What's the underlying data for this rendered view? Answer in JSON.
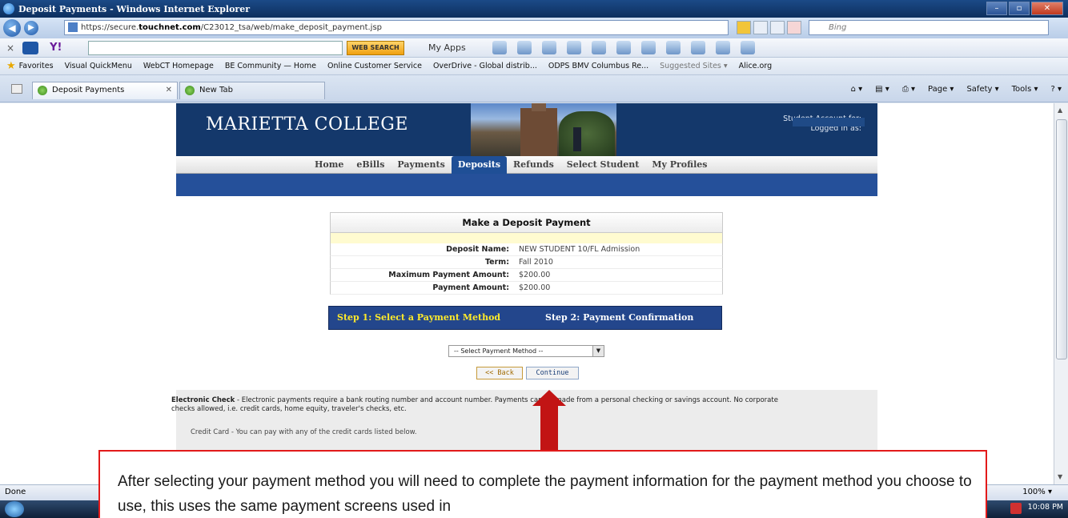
{
  "window": {
    "title": "Deposit Payments - Windows Internet Explorer"
  },
  "address_bar": {
    "url_prefix": "https://secure.",
    "url_domain": "touchnet.com",
    "url_path": "/C23012_tsa/web/make_deposit_payment.jsp",
    "search_placeholder": "Bing"
  },
  "toolbar": {
    "web_search_label": "WEB SEARCH",
    "my_apps_label": "My Apps"
  },
  "favorites": {
    "label": "Favorites",
    "items": [
      "Visual QuickMenu",
      "WebCT Homepage",
      "BE Community — Home",
      "Online Customer Service",
      "OverDrive - Global distrib...",
      "ODPS BMV Columbus Re...",
      "Suggested Sites ▾",
      "Alice.org"
    ]
  },
  "tabs": {
    "active": "Deposit Payments",
    "new_tab": "New Tab",
    "right_menu": [
      "Page ▾",
      "Safety ▾",
      "Tools ▾"
    ]
  },
  "site": {
    "college_name": "MARIETTA COLLEGE",
    "account_line1": "Student Account for:",
    "account_line2": "Logged in as:",
    "nav": [
      "Home",
      "eBills",
      "Payments",
      "Deposits",
      "Refunds",
      "Select Student",
      "My Profiles"
    ],
    "nav_active": "Deposits"
  },
  "deposit": {
    "title": "Make a Deposit Payment",
    "rows": [
      {
        "label": "Deposit Name:",
        "value": "NEW STUDENT 10/FL Admission"
      },
      {
        "label": "Term:",
        "value": "Fall 2010"
      },
      {
        "label": "Maximum Payment Amount:",
        "value": "$200.00"
      },
      {
        "label": "Payment Amount:",
        "value": "$200.00"
      }
    ]
  },
  "steps": {
    "step1": "Step 1: Select a Payment Method",
    "step2": "Step 2: Payment Confirmation"
  },
  "form": {
    "select_value": "-- Select Payment Method --",
    "back_label": "<< Back",
    "continue_label": "Continue"
  },
  "info": {
    "echeck_title": "Electronic Check",
    "echeck_text": " - Electronic payments require a bank routing number and account number. Payments can be made from a personal checking or savings account. No corporate checks allowed, i.e. credit cards, home equity, traveler's checks, etc.",
    "credit_text": "Credit Card - You can pay with any of the credit cards listed below."
  },
  "status": {
    "done": "Done",
    "zoom": "100% ▾",
    "clock": "10:08 PM"
  },
  "callout": {
    "text": "After selecting your payment method you will need to complete the payment information for the payment method you choose to use, this uses the same payment screens used in"
  },
  "colors": {
    "banner": "#14386b",
    "nav_active": "#1f4f96",
    "step_active": "#ffea2a",
    "callout_border": "#e21a1a",
    "arrow": "#c21414"
  }
}
